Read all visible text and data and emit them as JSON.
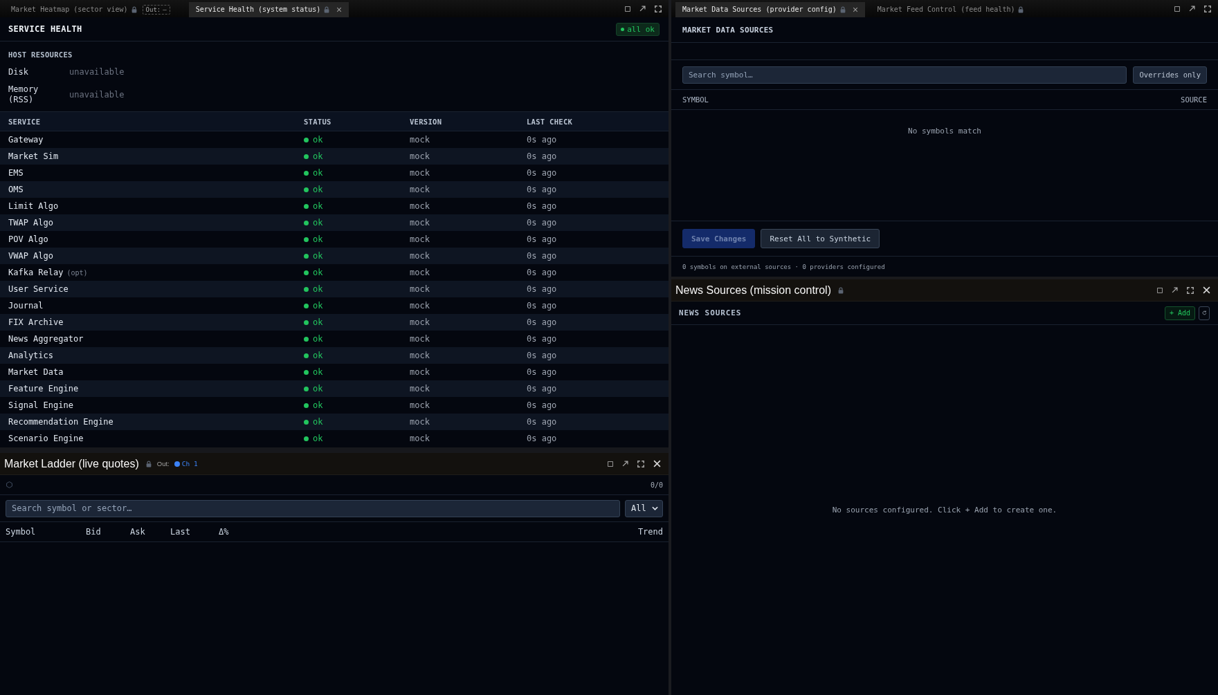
{
  "service_health_panel": {
    "tabs": [
      {
        "label": "Market Heatmap (sector view)",
        "selected": false,
        "locked": true,
        "output": {
          "label": "Out:",
          "channel": "–",
          "linked": false
        }
      },
      {
        "label": "Service Health (system status)",
        "selected": true,
        "locked": true
      }
    ],
    "title": "SERVICE HEALTH",
    "overall": {
      "label": "all ok",
      "healthy": true
    },
    "host_resources": {
      "title": "HOST RESOURCES",
      "items": [
        {
          "label": "Disk",
          "value": "unavailable"
        },
        {
          "label": "Memory (RSS)",
          "value": "unavailable"
        }
      ]
    },
    "table": {
      "columns": [
        "SERVICE",
        "STATUS",
        "VERSION",
        "LAST CHECK"
      ],
      "rows": [
        {
          "service": "Gateway",
          "status": "ok",
          "color": "#22c55e",
          "version": "mock",
          "last_check": "0s ago"
        },
        {
          "service": "Market Sim",
          "status": "ok",
          "color": "#22c55e",
          "version": "mock",
          "last_check": "0s ago"
        },
        {
          "service": "EMS",
          "status": "ok",
          "color": "#22c55e",
          "version": "mock",
          "last_check": "0s ago"
        },
        {
          "service": "OMS",
          "status": "ok",
          "color": "#22c55e",
          "version": "mock",
          "last_check": "0s ago"
        },
        {
          "service": "Limit Algo",
          "status": "ok",
          "color": "#22c55e",
          "version": "mock",
          "last_check": "0s ago"
        },
        {
          "service": "TWAP Algo",
          "status": "ok",
          "color": "#22c55e",
          "version": "mock",
          "last_check": "0s ago"
        },
        {
          "service": "POV Algo",
          "status": "ok",
          "color": "#22c55e",
          "version": "mock",
          "last_check": "0s ago"
        },
        {
          "service": "VWAP Algo",
          "status": "ok",
          "color": "#22c55e",
          "version": "mock",
          "last_check": "0s ago"
        },
        {
          "service": "Kafka Relay",
          "tag": "(opt)",
          "status": "ok",
          "color": "#22c55e",
          "version": "mock",
          "last_check": "0s ago"
        },
        {
          "service": "User Service",
          "status": "ok",
          "color": "#22c55e",
          "version": "mock",
          "last_check": "0s ago"
        },
        {
          "service": "Journal",
          "status": "ok",
          "color": "#22c55e",
          "version": "mock",
          "last_check": "0s ago"
        },
        {
          "service": "FIX Archive",
          "status": "ok",
          "color": "#22c55e",
          "version": "mock",
          "last_check": "0s ago"
        },
        {
          "service": "News Aggregator",
          "status": "ok",
          "color": "#22c55e",
          "version": "mock",
          "last_check": "0s ago"
        },
        {
          "service": "Analytics",
          "status": "ok",
          "color": "#22c55e",
          "version": "mock",
          "last_check": "0s ago"
        },
        {
          "service": "Market Data",
          "status": "ok",
          "color": "#22c55e",
          "version": "mock",
          "last_check": "0s ago"
        },
        {
          "service": "Feature Engine",
          "status": "ok",
          "color": "#22c55e",
          "version": "mock",
          "last_check": "0s ago"
        },
        {
          "service": "Signal Engine",
          "status": "ok",
          "color": "#22c55e",
          "version": "mock",
          "last_check": "0s ago"
        },
        {
          "service": "Recommendation Engine",
          "status": "ok",
          "color": "#22c55e",
          "version": "mock",
          "last_check": "0s ago"
        },
        {
          "service": "Scenario Engine",
          "status": "ok",
          "color": "#22c55e",
          "version": "mock",
          "last_check": "0s ago"
        }
      ]
    }
  },
  "market_ladder_panel": {
    "title": "Market Ladder (live quotes)",
    "locked": true,
    "output": {
      "label": "Out:",
      "channel": "Ch 1",
      "linked": true
    },
    "count": "0/0",
    "search": {
      "placeholder": "Search symbol or sector…"
    },
    "filter": {
      "value": "All"
    },
    "columns": [
      "Symbol",
      "Bid",
      "Ask",
      "Last",
      "Δ%",
      "Trend"
    ]
  },
  "market_data_sources_panel": {
    "tabs": [
      {
        "label": "Market Data Sources (provider config)",
        "selected": true,
        "locked": true
      },
      {
        "label": "Market Feed Control (feed health)",
        "selected": false,
        "locked": true
      }
    ],
    "title": "MARKET DATA SOURCES",
    "search": {
      "placeholder": "Search symbol…"
    },
    "overrides_only": {
      "label": "Overrides only",
      "on": false
    },
    "columns": [
      "SYMBOL",
      "SOURCE"
    ],
    "empty_message": "No symbols match",
    "buttons": [
      {
        "label": "Save Changes",
        "kind": "primary",
        "disabled": true
      },
      {
        "label": "Reset All to Synthetic",
        "kind": "secondary",
        "disabled": false
      }
    ],
    "summary": "0 symbols on external sources · 0 providers configured"
  },
  "news_sources_panel": {
    "title": "News Sources (mission control)",
    "locked": true,
    "heading": "NEWS SOURCES",
    "add_button": "+ Add",
    "empty_message": "No sources configured. Click + Add to create one."
  }
}
